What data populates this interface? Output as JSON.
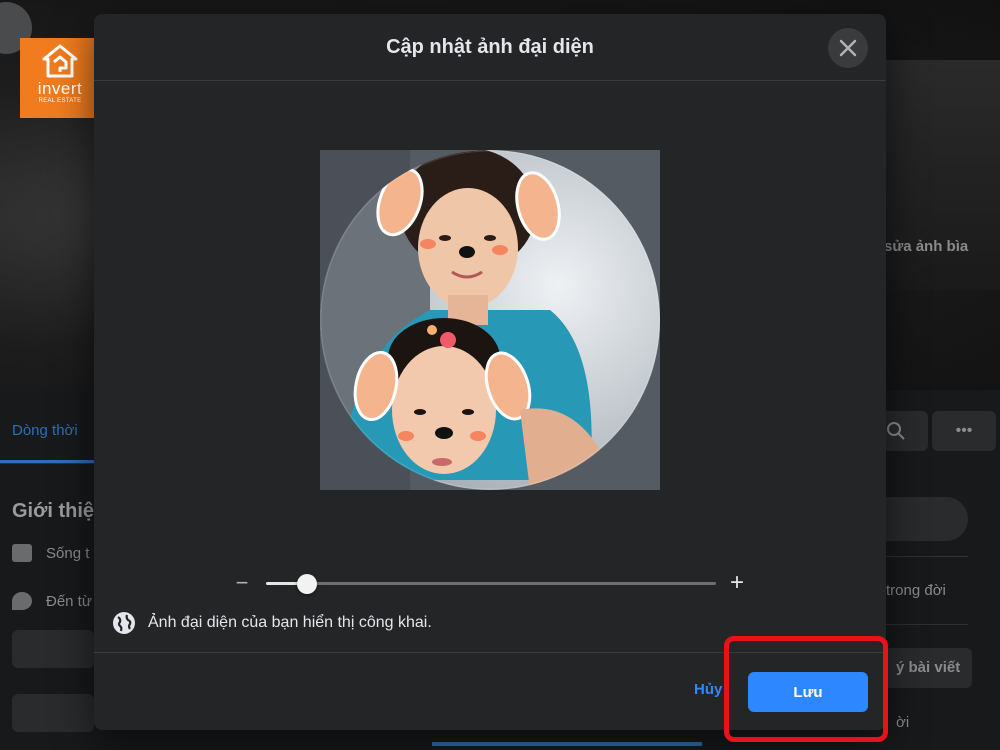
{
  "background_page": {
    "tab_label": "Dòng thời",
    "intro_title": "Giới thiệ",
    "intro_items": [
      {
        "icon": "home-icon",
        "label": "Sống t"
      },
      {
        "icon": "location-pin-icon",
        "label": "Đến từ"
      }
    ],
    "edit_cover_label": "sửa ảnh bìa",
    "right_text_life": "trong đời",
    "right_button_posts": "ý bài viết",
    "right_text_bottom": "ời"
  },
  "logo": {
    "name": "invert",
    "tagline": "REAL ESTATE",
    "color": "#f07c1f"
  },
  "modal": {
    "title": "Cập nhật ảnh đại diện",
    "close_icon": "close-icon",
    "zoom": {
      "minus_symbol": "−",
      "plus_symbol": "+",
      "level": 0.09
    },
    "privacy_icon": "globe-icon",
    "privacy_text": "Ảnh đại diện của bạn hiển thị công khai.",
    "cancel_label": "Hủy",
    "save_label": "Lưu",
    "accent_color": "#2d88ff",
    "highlight_color": "#e8121b"
  }
}
